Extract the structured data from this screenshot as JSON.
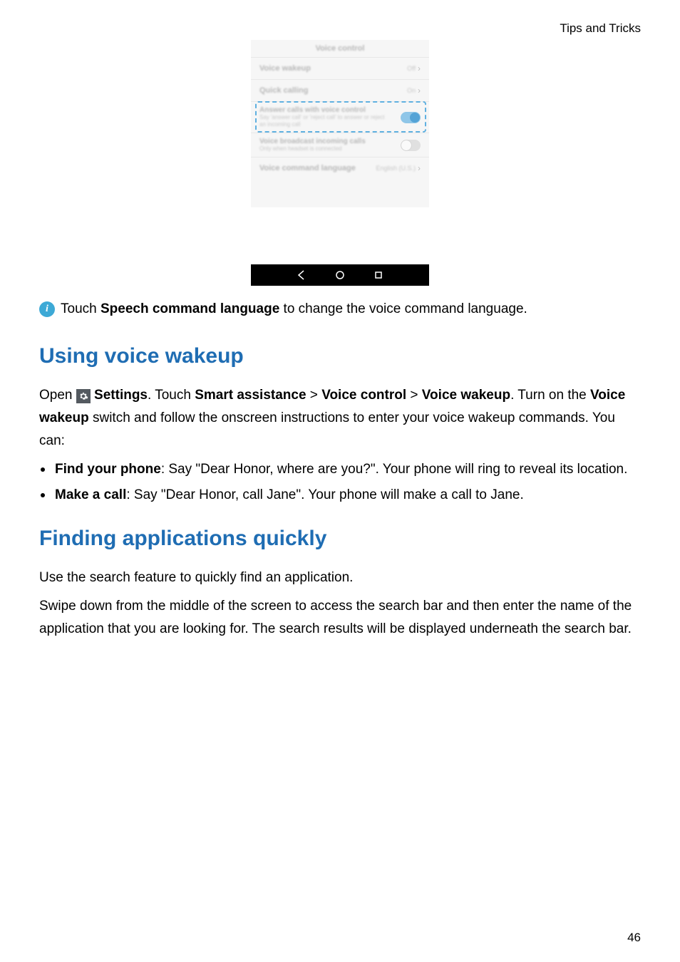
{
  "header": {
    "section": "Tips and Tricks"
  },
  "phone": {
    "title": "Voice control",
    "rows": {
      "wakeup": {
        "label": "Voice wakeup",
        "value": "Off"
      },
      "quick": {
        "label": "Quick calling",
        "value": "On"
      },
      "answer": {
        "title": "Answer calls with voice control",
        "sub": "Say 'answer call' or 'reject call' to answer or reject an incoming call",
        "on": true
      },
      "broadcast": {
        "title": "Voice broadcast incoming calls",
        "sub": "Only when headset is connected",
        "on": false
      },
      "lang": {
        "label": "Voice command language",
        "value": "English (U.S.)"
      }
    }
  },
  "info": {
    "pre": "Touch ",
    "bold": "Speech command language",
    "post": " to change the voice command language."
  },
  "sections": {
    "wakeup": {
      "heading": "Using voice wakeup",
      "p1_pre": "Open ",
      "p1_settings": "Settings",
      "p1_after_settings": ". Touch ",
      "p1_b2": "Smart assistance",
      "p1_gt1": " > ",
      "p1_b3": "Voice control",
      "p1_gt2": " > ",
      "p1_b4": "Voice wakeup",
      "p1_post": ". Turn on the ",
      "p1_b5": "Voice wakeup",
      "p1_tail": " switch and follow the onscreen instructions to enter your voice wakeup commands. You can:",
      "li1_b": "Find your phone",
      "li1_t": ": Say \"Dear Honor, where are you?\". Your phone will ring to reveal its location.",
      "li2_b": "Make a call",
      "li2_t": ": Say \"Dear Honor, call Jane\". Your phone will make a call to Jane."
    },
    "find": {
      "heading": "Finding applications quickly",
      "p1": "Use the search feature to quickly find an application.",
      "p2": "Swipe down from the middle of the screen to access the search bar and then enter the name of the application that you are looking for. The search results will be displayed underneath the search bar."
    }
  },
  "page_number": "46"
}
